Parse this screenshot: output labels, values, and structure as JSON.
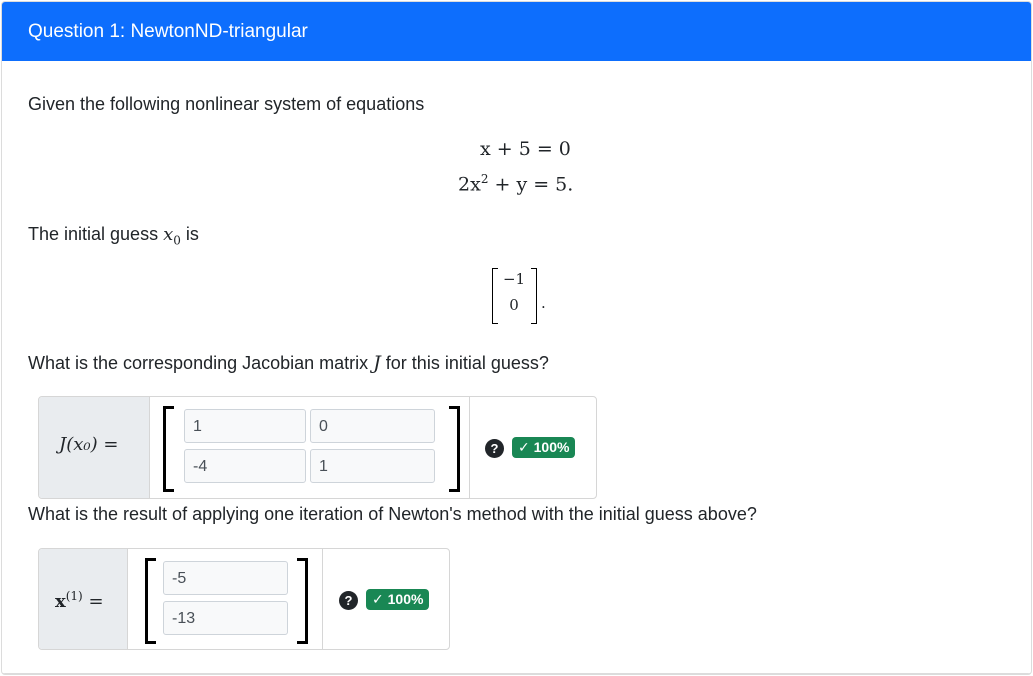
{
  "header": {
    "title": "Question 1: NewtonND-triangular"
  },
  "intro": "Given the following nonlinear system of equations",
  "equations": {
    "eq1": "x + 5 = 0",
    "eq2_prefix": "2x",
    "eq2_exp": "2",
    "eq2_suffix": " + y = 5."
  },
  "initial_guess_text": {
    "before": "The initial guess ",
    "var": "x",
    "sub": "0",
    "after": " is"
  },
  "initial_vector": {
    "top": "−1",
    "bottom": "0",
    "end": "."
  },
  "q1": {
    "prefix": "What is the corresponding Jacobian matrix ",
    "var": "J",
    "suffix": " for this initial guess?"
  },
  "jacobian": {
    "label": "J(x₀) =",
    "cells": [
      "1",
      "0",
      "-4",
      "1"
    ],
    "badge": "✓ 100%"
  },
  "q2": "What is the result of applying one iteration of Newton's method with the initial guess above?",
  "newton": {
    "label_base": "x",
    "label_sup": "(1)",
    "label_eq": " =",
    "cells": [
      "-5",
      "-13"
    ],
    "badge": "✓ 100%"
  },
  "help_icon": "?",
  "colors": {
    "header": "#0d6efd",
    "badge": "#198754"
  }
}
